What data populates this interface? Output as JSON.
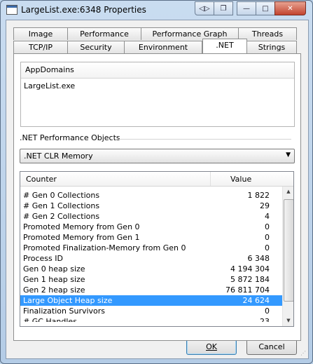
{
  "window": {
    "title": "LargeList.exe:6348 Properties",
    "buttons": {
      "back": "◁▷",
      "restore_icon": "❐",
      "minimize": "—",
      "maximize": "□",
      "close": "✕"
    }
  },
  "tabs": {
    "row1": [
      "Image",
      "Performance",
      "Performance Graph",
      "Threads"
    ],
    "row2": [
      "TCP/IP",
      "Security",
      "Environment",
      ".NET",
      "Strings"
    ],
    "active": ".NET"
  },
  "appdomains": {
    "header": "AppDomains",
    "items": [
      "LargeList.exe"
    ]
  },
  "perf_objects": {
    "label": ".NET Performance Objects",
    "selected": ".NET CLR Memory"
  },
  "counters": {
    "col_counter": "Counter",
    "col_value": "Value",
    "rows": [
      {
        "name": "# Gen 0 Collections",
        "value": "1 822"
      },
      {
        "name": "# Gen 1 Collections",
        "value": "29"
      },
      {
        "name": "# Gen 2 Collections",
        "value": "4"
      },
      {
        "name": "Promoted Memory from Gen 0",
        "value": "0"
      },
      {
        "name": "Promoted Memory from Gen 1",
        "value": "0"
      },
      {
        "name": "Promoted Finalization-Memory from Gen 0",
        "value": "0"
      },
      {
        "name": "Process ID",
        "value": "6 348"
      },
      {
        "name": "Gen 0 heap size",
        "value": "4 194 304"
      },
      {
        "name": "Gen 1 heap size",
        "value": "5 872 184"
      },
      {
        "name": "Gen 2 heap size",
        "value": "76 811 704"
      },
      {
        "name": "Large Object Heap size",
        "value": "24 624"
      },
      {
        "name": "Finalization Survivors",
        "value": "0"
      },
      {
        "name": "# GC Handles",
        "value": "23"
      }
    ],
    "selected_index": 10
  },
  "dialog_buttons": {
    "ok": "OK",
    "cancel": "Cancel"
  }
}
